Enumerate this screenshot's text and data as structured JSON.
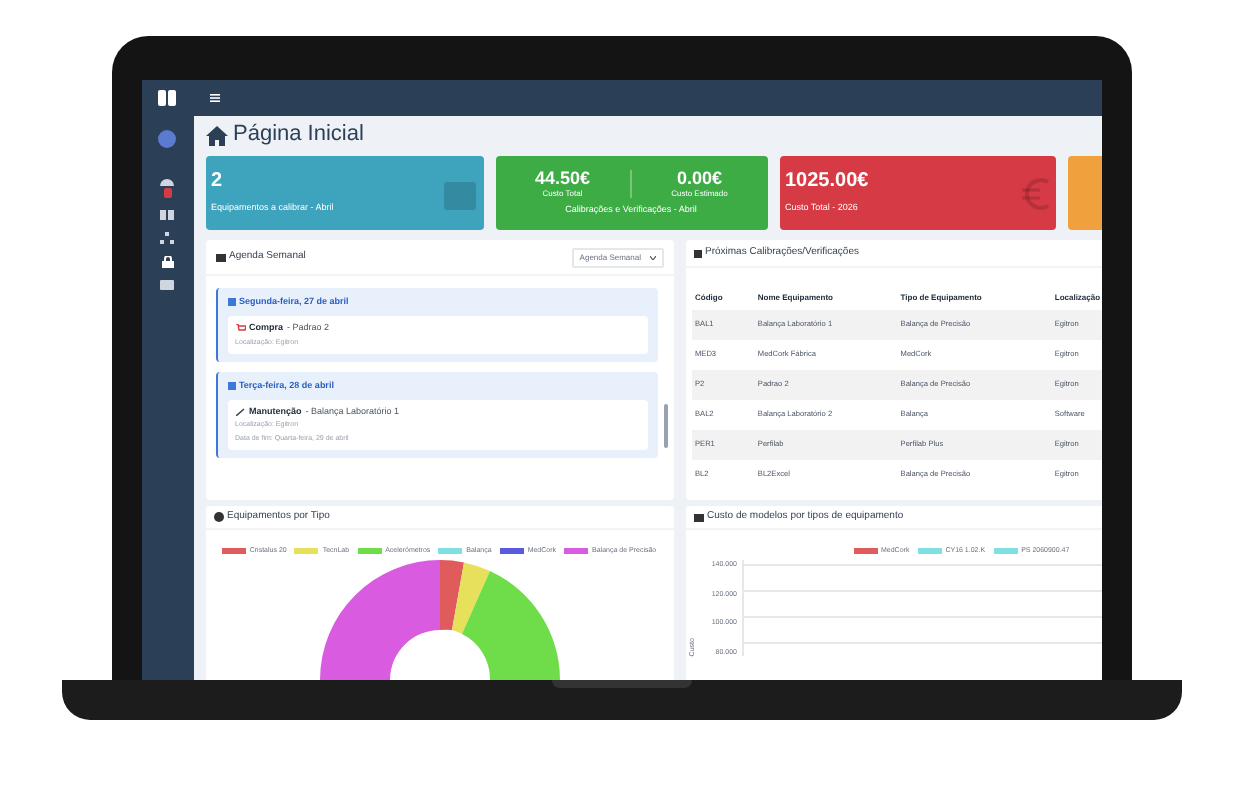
{
  "page_title": "Página Inicial",
  "cards": [
    {
      "kind": "single",
      "color": "#3ea3bd",
      "value": "2",
      "label": "Equipamentos a calibrar - Abril"
    },
    {
      "kind": "split",
      "color": "#3eac45",
      "values": [
        {
          "value": "44.50€",
          "caption": "Custo Total"
        },
        {
          "value": "0.00€",
          "caption": "Custo Estimado"
        }
      ],
      "label": "Calibrações e Verificações - Abril"
    },
    {
      "kind": "single",
      "color": "#d63a45",
      "value": "1025.00€",
      "label": "Custo Total - 2026"
    },
    {
      "kind": "blank",
      "color": "#f0a03c"
    }
  ],
  "agenda": {
    "title": "Agenda Semanal",
    "select_value": "Agenda Semanal",
    "days": [
      {
        "date": "Segunda-feira, 27 de abril",
        "events": [
          {
            "kind": "purchase",
            "type": "Compra",
            "item": "- Padrao 2",
            "details": [
              "Localização: Egitron"
            ]
          }
        ]
      },
      {
        "date": "Terça-feira, 28 de abril",
        "events": [
          {
            "kind": "maintenance",
            "type": "Manutenção",
            "item": "- Balança Laboratório 1",
            "details": [
              "Localização: Egitron",
              "Data de fim: Quarta-feira, 29 de abril"
            ]
          }
        ]
      }
    ]
  },
  "upcoming": {
    "title": "Próximas Calibrações/Verificações",
    "columns": [
      "Código",
      "Nome Equipamento",
      "Tipo de Equipamento",
      "Localização"
    ],
    "rows": [
      [
        "BAL1",
        "Balança Laboratório 1",
        "Balança de Precisão",
        "Egitron"
      ],
      [
        "MED3",
        "MedCork Fábrica",
        "MedCork",
        "Egitron"
      ],
      [
        "P2",
        "Padrao 2",
        "Balança de Precisão",
        "Egitron"
      ],
      [
        "BAL2",
        "Balança Laboratório 2",
        "Balança",
        "Software"
      ],
      [
        "PER1",
        "Perfilab",
        "Perfilab Plus",
        "Egitron"
      ],
      [
        "BL2",
        "BL2Excel",
        "Balança de Precisão",
        "Egitron"
      ]
    ]
  },
  "types_chart": {
    "title": "Equipamentos por Tipo",
    "legend": [
      {
        "label": "Cristalus 20",
        "color": "#e05c5c"
      },
      {
        "label": "TecnLab",
        "color": "#e6e05a"
      },
      {
        "label": "Acelerómetros",
        "color": "#6fdc4a"
      },
      {
        "label": "Balança",
        "color": "#7ee0e0"
      },
      {
        "label": "MedCork",
        "color": "#5a5ae0"
      },
      {
        "label": "Balança de Precisão",
        "color": "#d95be0"
      }
    ]
  },
  "cost_chart": {
    "title": "Custo de modelos por tipos de equipamento",
    "ylabel": "Custo",
    "yticks": [
      "140.000",
      "120.000",
      "100.000",
      "80.000"
    ],
    "legend": [
      {
        "label": "MedCork",
        "color": "#e05c5c"
      },
      {
        "label": "CY16 1.02.K",
        "color": "#7ee0e0"
      },
      {
        "label": "PS 2060900.47",
        "color": "#7ee0e0"
      }
    ]
  }
}
